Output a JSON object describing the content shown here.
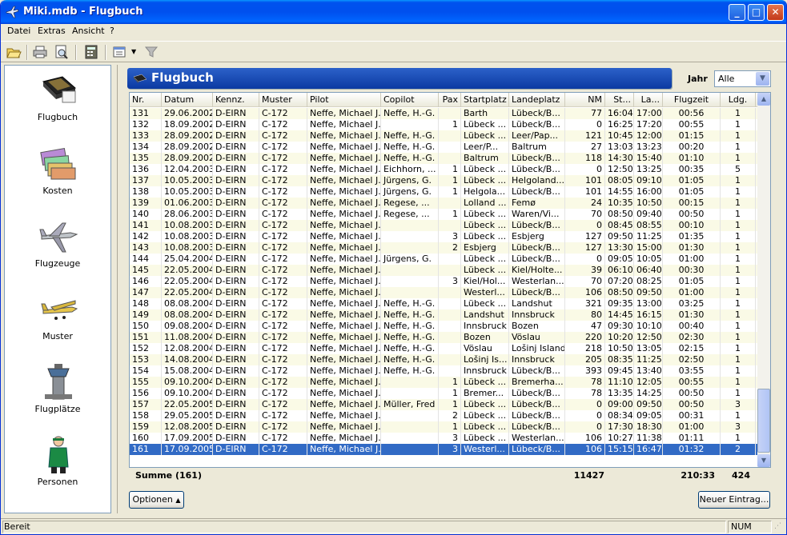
{
  "window": {
    "title": "Miki.mdb - Flugbuch",
    "min_icon": "minimize-icon",
    "max_icon": "maximize-icon",
    "close_icon": "close-icon"
  },
  "menu": [
    "Datei",
    "Extras",
    "Ansicht",
    "?"
  ],
  "toolbar": [
    "open-folder-icon",
    "print-icon",
    "print-preview-icon",
    "calculator-icon",
    "view-icon",
    "dropdown-arrow-icon",
    "filter-icon"
  ],
  "sidebar": [
    {
      "label": "Flugbuch",
      "icon": "logbook-icon"
    },
    {
      "label": "Kosten",
      "icon": "money-icon"
    },
    {
      "label": "Flugzeuge",
      "icon": "airplane-icon"
    },
    {
      "label": "Muster",
      "icon": "aircraft-type-icon"
    },
    {
      "label": "Flugplätze",
      "icon": "airport-tower-icon"
    },
    {
      "label": "Personen",
      "icon": "person-icon"
    }
  ],
  "header": {
    "title": "Flugbuch",
    "jahr_label": "Jahr",
    "jahr_value": "Alle"
  },
  "table": {
    "columns": [
      "Nr.",
      "Datum",
      "Kennz.",
      "Muster",
      "Pilot",
      "Copilot",
      "Pax",
      "Startplatz",
      "Landeplatz",
      "NM",
      "St...",
      "La...",
      "Flugzeit",
      "Ldg."
    ],
    "rows": [
      [
        "131",
        "29.06.2002",
        "D-EIRN",
        "C-172",
        "Neffe, Michael J.",
        "Neffe, H.-G.",
        "",
        "Barth",
        "Lübeck/B...",
        "77",
        "16:04",
        "17:00",
        "00:56",
        "1"
      ],
      [
        "132",
        "18.09.2002",
        "D-EIRN",
        "C-172",
        "Neffe, Michael J.",
        "",
        "1",
        "Lübeck ...",
        "Lübeck/B...",
        "0",
        "16:25",
        "17:20",
        "00:55",
        "1"
      ],
      [
        "133",
        "28.09.2002",
        "D-EIRN",
        "C-172",
        "Neffe, Michael J.",
        "Neffe, H.-G.",
        "",
        "Lübeck ...",
        "Leer/Pap...",
        "121",
        "10:45",
        "12:00",
        "01:15",
        "1"
      ],
      [
        "134",
        "28.09.2002",
        "D-EIRN",
        "C-172",
        "Neffe, Michael J.",
        "Neffe, H.-G.",
        "",
        "Leer/P...",
        "Baltrum",
        "27",
        "13:03",
        "13:23",
        "00:20",
        "1"
      ],
      [
        "135",
        "28.09.2002",
        "D-EIRN",
        "C-172",
        "Neffe, Michael J.",
        "Neffe, H.-G.",
        "",
        "Baltrum",
        "Lübeck/B...",
        "118",
        "14:30",
        "15:40",
        "01:10",
        "1"
      ],
      [
        "136",
        "12.04.2003",
        "D-EIRN",
        "C-172",
        "Neffe, Michael J.",
        "Eichhorn, ...",
        "1",
        "Lübeck ...",
        "Lübeck/B...",
        "0",
        "12:50",
        "13:25",
        "00:35",
        "5"
      ],
      [
        "137",
        "10.05.2003",
        "D-EIRN",
        "C-172",
        "Neffe, Michael J.",
        "Jürgens, G.",
        "1",
        "Lübeck ...",
        "Helgoland...",
        "101",
        "08:05",
        "09:10",
        "01:05",
        "1"
      ],
      [
        "138",
        "10.05.2003",
        "D-EIRN",
        "C-172",
        "Neffe, Michael J.",
        "Jürgens, G.",
        "1",
        "Helgola...",
        "Lübeck/B...",
        "101",
        "14:55",
        "16:00",
        "01:05",
        "1"
      ],
      [
        "139",
        "01.06.2003",
        "D-EIRN",
        "C-172",
        "Neffe, Michael J.",
        "Regese, ...",
        "",
        "Lolland ...",
        "Femø",
        "24",
        "10:35",
        "10:50",
        "00:15",
        "1"
      ],
      [
        "140",
        "28.06.2003",
        "D-EIRN",
        "C-172",
        "Neffe, Michael J.",
        "Regese, ...",
        "1",
        "Lübeck ...",
        "Waren/Vi...",
        "70",
        "08:50",
        "09:40",
        "00:50",
        "1"
      ],
      [
        "141",
        "10.08.2003",
        "D-EIRN",
        "C-172",
        "Neffe, Michael J.",
        "",
        "",
        "Lübeck ...",
        "Lübeck/B...",
        "0",
        "08:45",
        "08:55",
        "00:10",
        "1"
      ],
      [
        "142",
        "10.08.2003",
        "D-EIRN",
        "C-172",
        "Neffe, Michael J.",
        "",
        "3",
        "Lübeck ...",
        "Esbjerg",
        "127",
        "09:50",
        "11:25",
        "01:35",
        "1"
      ],
      [
        "143",
        "10.08.2003",
        "D-EIRN",
        "C-172",
        "Neffe, Michael J.",
        "",
        "2",
        "Esbjerg",
        "Lübeck/B...",
        "127",
        "13:30",
        "15:00",
        "01:30",
        "1"
      ],
      [
        "144",
        "25.04.2004",
        "D-EIRN",
        "C-172",
        "Neffe, Michael J.",
        "Jürgens, G.",
        "",
        "Lübeck ...",
        "Lübeck/B...",
        "0",
        "09:05",
        "10:05",
        "01:00",
        "1"
      ],
      [
        "145",
        "22.05.2004",
        "D-EIRN",
        "C-172",
        "Neffe, Michael J.",
        "",
        "",
        "Lübeck ...",
        "Kiel/Holte...",
        "39",
        "06:10",
        "06:40",
        "00:30",
        "1"
      ],
      [
        "146",
        "22.05.2004",
        "D-EIRN",
        "C-172",
        "Neffe, Michael J.",
        "",
        "3",
        "Kiel/Hol...",
        "Westerlan...",
        "70",
        "07:20",
        "08:25",
        "01:05",
        "1"
      ],
      [
        "147",
        "22.05.2004",
        "D-EIRN",
        "C-172",
        "Neffe, Michael J.",
        "",
        "",
        "Westerl...",
        "Lübeck/B...",
        "106",
        "08:50",
        "09:50",
        "01:00",
        "1"
      ],
      [
        "148",
        "08.08.2004",
        "D-EIRN",
        "C-172",
        "Neffe, Michael J.",
        "Neffe, H.-G.",
        "",
        "Lübeck ...",
        "Landshut",
        "321",
        "09:35",
        "13:00",
        "03:25",
        "1"
      ],
      [
        "149",
        "08.08.2004",
        "D-EIRN",
        "C-172",
        "Neffe, Michael J.",
        "Neffe, H.-G.",
        "",
        "Landshut",
        "Innsbruck",
        "80",
        "14:45",
        "16:15",
        "01:30",
        "1"
      ],
      [
        "150",
        "09.08.2004",
        "D-EIRN",
        "C-172",
        "Neffe, Michael J.",
        "Neffe, H.-G.",
        "",
        "Innsbruck",
        "Bozen",
        "47",
        "09:30",
        "10:10",
        "00:40",
        "1"
      ],
      [
        "151",
        "11.08.2004",
        "D-EIRN",
        "C-172",
        "Neffe, Michael J.",
        "Neffe, H.-G.",
        "",
        "Bozen",
        "Vöslau",
        "220",
        "10:20",
        "12:50",
        "02:30",
        "1"
      ],
      [
        "152",
        "12.08.2004",
        "D-EIRN",
        "C-172",
        "Neffe, Michael J.",
        "Neffe, H.-G.",
        "",
        "Vöslau",
        "Lošinj Island",
        "218",
        "10:50",
        "13:05",
        "02:15",
        "1"
      ],
      [
        "153",
        "14.08.2004",
        "D-EIRN",
        "C-172",
        "Neffe, Michael J.",
        "Neffe, H.-G.",
        "",
        "Lošinj Is...",
        "Innsbruck",
        "205",
        "08:35",
        "11:25",
        "02:50",
        "1"
      ],
      [
        "154",
        "15.08.2004",
        "D-EIRN",
        "C-172",
        "Neffe, Michael J.",
        "Neffe, H.-G.",
        "",
        "Innsbruck",
        "Lübeck/B...",
        "393",
        "09:45",
        "13:40",
        "03:55",
        "1"
      ],
      [
        "155",
        "09.10.2004",
        "D-EIRN",
        "C-172",
        "Neffe, Michael J.",
        "",
        "1",
        "Lübeck ...",
        "Bremerha...",
        "78",
        "11:10",
        "12:05",
        "00:55",
        "1"
      ],
      [
        "156",
        "09.10.2004",
        "D-EIRN",
        "C-172",
        "Neffe, Michael J.",
        "",
        "1",
        "Bremer...",
        "Lübeck/B...",
        "78",
        "13:35",
        "14:25",
        "00:50",
        "1"
      ],
      [
        "157",
        "22.05.2005",
        "D-EIRN",
        "C-172",
        "Neffe, Michael J.",
        "Müller, Fred",
        "1",
        "Lübeck ...",
        "Lübeck/B...",
        "0",
        "09:00",
        "09:50",
        "00:50",
        "3"
      ],
      [
        "158",
        "29.05.2005",
        "D-EIRN",
        "C-172",
        "Neffe, Michael J.",
        "",
        "2",
        "Lübeck ...",
        "Lübeck/B...",
        "0",
        "08:34",
        "09:05",
        "00:31",
        "1"
      ],
      [
        "159",
        "12.08.2005",
        "D-EIRN",
        "C-172",
        "Neffe, Michael J.",
        "",
        "1",
        "Lübeck ...",
        "Lübeck/B...",
        "0",
        "17:30",
        "18:30",
        "01:00",
        "3"
      ],
      [
        "160",
        "17.09.2005",
        "D-EIRN",
        "C-172",
        "Neffe, Michael J.",
        "",
        "3",
        "Lübeck ...",
        "Westerlan...",
        "106",
        "10:27",
        "11:38",
        "01:11",
        "1"
      ],
      [
        "161",
        "17.09.2005",
        "D-EIRN",
        "C-172",
        "Neffe, Michael J.",
        "",
        "3",
        "Westerl...",
        "Lübeck/B...",
        "106",
        "15:15",
        "16:47",
        "01:32",
        "2"
      ]
    ],
    "selected_row": 30
  },
  "summary": {
    "label": "Summe (161)",
    "nm": "11427",
    "flugzeit": "210:33",
    "ldg": "424"
  },
  "buttons": {
    "options": "Optionen",
    "new_entry": "Neuer Eintrag..."
  },
  "status": {
    "text": "Bereit",
    "num": "NUM"
  }
}
